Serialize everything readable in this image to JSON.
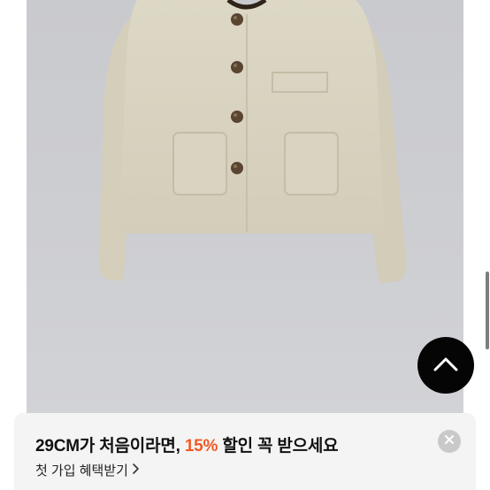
{
  "product": {
    "image_description_icon": "cropped-boucle-jacket-image"
  },
  "colors": {
    "accent": "#f05a24",
    "banner_bg": "#f4f4f4",
    "scroll_top_bg": "#050505"
  },
  "icons": {
    "scroll_top": "chevron-up-icon",
    "close": "close-icon",
    "link_arrow": "chevron-right-icon"
  },
  "banner": {
    "title_prefix": "29CM가 처음이라면, ",
    "title_percent": "15%",
    "title_suffix": " 할인 꼭 받으세요",
    "link_label": "첫 가입 혜택받기"
  }
}
